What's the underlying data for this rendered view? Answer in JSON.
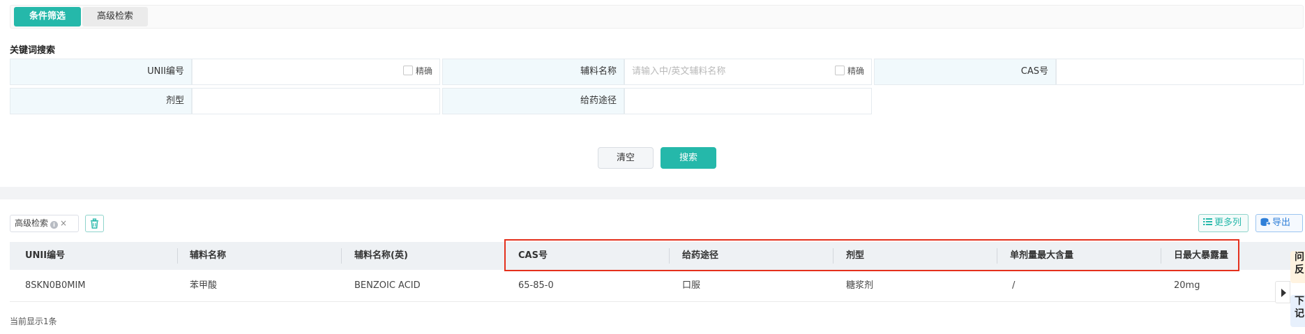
{
  "tabs": [
    {
      "label": "条件筛选",
      "active": true
    },
    {
      "label": "高级检索",
      "active": false
    }
  ],
  "keyword_section_title": "关键词搜索",
  "form": {
    "unii_label": "UNII编号",
    "unii_value": "",
    "exact_label": "精确",
    "excipient_label": "辅料名称",
    "excipient_placeholder": "请输入中/英文辅料名称",
    "cas_label": "CAS号",
    "cas_value": "",
    "dosage_form_label": "剂型",
    "dosage_form_value": "",
    "route_label": "给药途径",
    "route_value": ""
  },
  "buttons": {
    "clear": "清空",
    "search": "搜索"
  },
  "filter_tag": {
    "label": "高级检索",
    "info_icon": "i",
    "close_icon": "×"
  },
  "toolbar": {
    "more_columns": "更多列",
    "export": "导出"
  },
  "table": {
    "columns": [
      "UNII编号",
      "辅料名称",
      "辅料名称(英)",
      "CAS号",
      "给药途径",
      "剂型",
      "单剂量最大含量",
      "日最大暴露量"
    ],
    "rows": [
      [
        "8SKN0B0MIM",
        "苯甲酸",
        "BENZOIC ACID",
        "65-85-0",
        "口服",
        "糖浆剂",
        "/",
        "20mg"
      ]
    ]
  },
  "footer": {
    "count_text": "当前显示1条"
  },
  "side_cards": [
    {
      "text": "问反"
    },
    {
      "text": "下记"
    }
  ],
  "colors": {
    "accent": "#25b8aa",
    "label_bg": "#f1f9fc",
    "highlight_border": "#e4301c",
    "export_blue": "#2f7fd8"
  }
}
